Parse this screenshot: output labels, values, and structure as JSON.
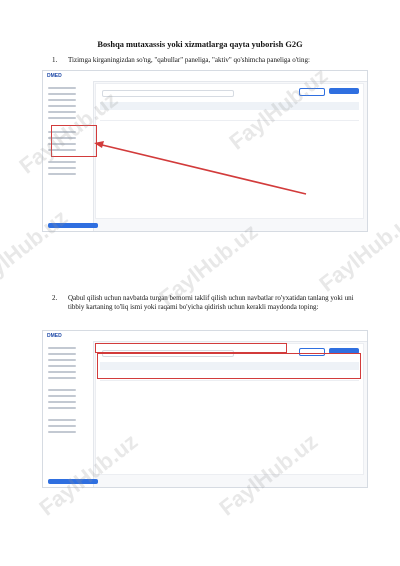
{
  "title": "Boshqa mutaxassis yoki xizmatlarga qayta yuborish G2G",
  "steps": [
    {
      "num": "1.",
      "text": "Tizimga kirganingizdan so'ng, \"qabullar\" paneliga, \"aktiv\" qo'shimcha paneliga o'ting:"
    },
    {
      "num": "2.",
      "text": "Qabul qilish uchun navbatda turgan bemorni taklif qilish uchun navbatlar ro'yxatidan tanlang yoki uni tibbiy kartaning to'liq ismi yoki raqami bo'yicha qidirish uchun kerakli maydonda toping:"
    }
  ],
  "screenshot_logo": "DMED",
  "watermark": "FaylHub.uz",
  "colors": {
    "highlight": "#d23b3b",
    "brand": "#2f6fe0"
  }
}
